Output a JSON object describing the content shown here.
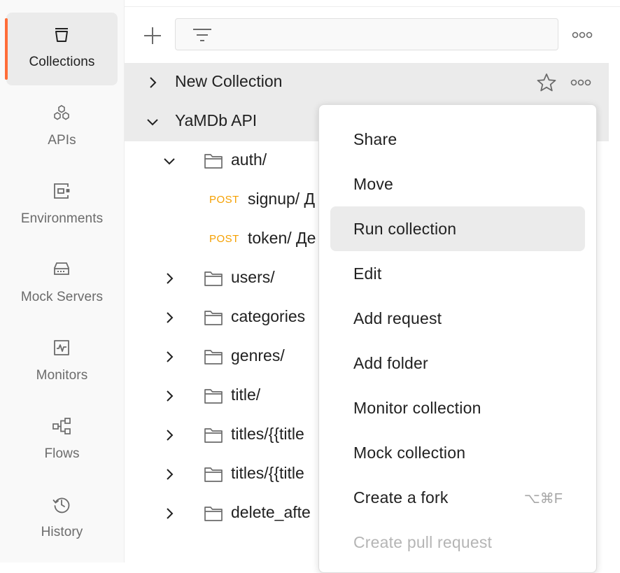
{
  "colors": {
    "accent": "#ff6c37",
    "post": "#f5a000",
    "icon": "#6b6b6b"
  },
  "rail": [
    {
      "label": "Collections",
      "icon": "collections-icon",
      "active": true
    },
    {
      "label": "APIs",
      "icon": "apis-icon"
    },
    {
      "label": "Environments",
      "icon": "environments-icon"
    },
    {
      "label": "Mock Servers",
      "icon": "mock-servers-icon"
    },
    {
      "label": "Monitors",
      "icon": "monitors-icon"
    },
    {
      "label": "Flows",
      "icon": "flows-icon"
    },
    {
      "label": "History",
      "icon": "history-icon"
    }
  ],
  "toolbar": {
    "add_icon": "plus-icon",
    "filter_icon": "filter-icon",
    "more_icon": "more-icon"
  },
  "tree": {
    "new_collection": "New Collection",
    "yamdb": "YaMDb API",
    "auth": "auth/",
    "signup_method": "POST",
    "signup": "signup/ Д",
    "token_method": "POST",
    "token": "token/ Де",
    "users": "users/",
    "categories": "categories",
    "genres": "genres/",
    "title": "title/",
    "titles1": "titles/{{title",
    "titles2": "titles/{{title",
    "delete_after": "delete_afte"
  },
  "menu": {
    "share": "Share",
    "move": "Move",
    "run_collection": "Run collection",
    "edit": "Edit",
    "add_request": "Add request",
    "add_folder": "Add folder",
    "monitor_collection": "Monitor collection",
    "mock_collection": "Mock collection",
    "create_fork": "Create a fork",
    "create_fork_shortcut": "⌥⌘F",
    "create_pull_request": "Create pull request"
  }
}
